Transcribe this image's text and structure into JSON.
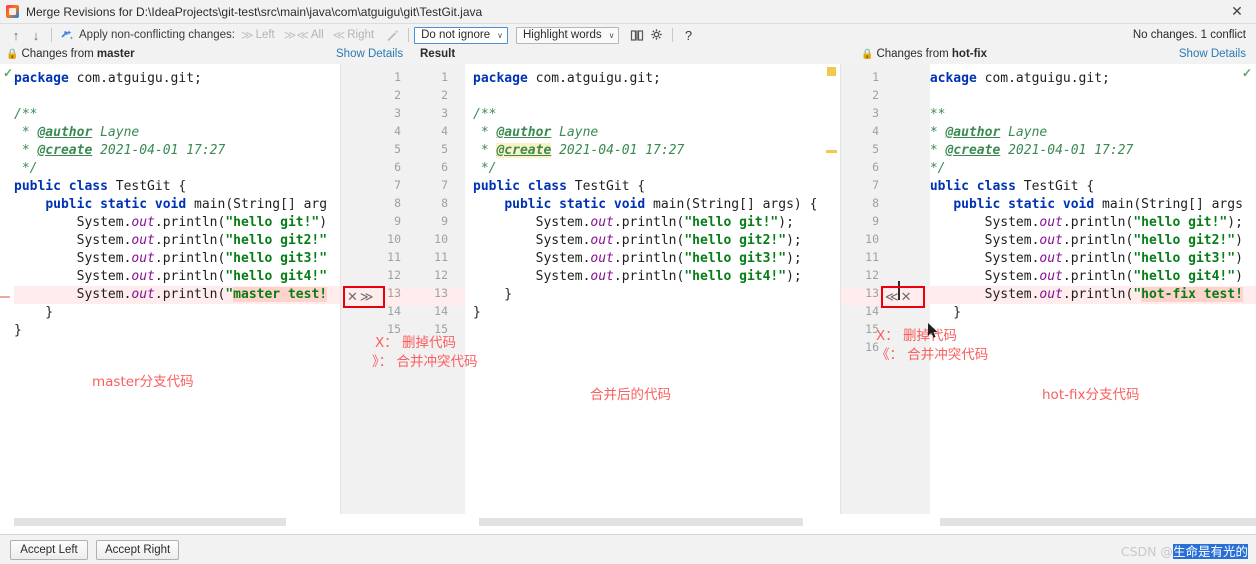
{
  "window": {
    "title": "Merge Revisions for D:\\IdeaProjects\\git-test\\src\\main\\java\\com\\atguigu\\git\\TestGit.java",
    "app_icon": "intellij-idea-icon",
    "close_label": "✕"
  },
  "toolbar": {
    "prev_icon": "↑",
    "next_icon": "↓",
    "magic_apply_icon": "apply-non-conflicting-icon",
    "apply_label": "Apply non-conflicting changes:",
    "actions": [
      {
        "name": "apply-left",
        "chev": "≫",
        "label": "Left"
      },
      {
        "name": "apply-all",
        "chev": "≫≪",
        "label": "All"
      },
      {
        "name": "apply-right",
        "chev": "≪",
        "label": "Right"
      }
    ],
    "wand_icon": "magic-wand-icon",
    "ignore_combo": {
      "value": "Do not ignore",
      "arrow": "∨"
    },
    "highlight_combo": {
      "value": "Highlight words",
      "arrow": "∨"
    },
    "columns_icon": "side-by-side-view-icon",
    "settings_icon": "gear-icon",
    "help_icon": "?"
  },
  "subbar": {
    "left_prefix": "Changes from",
    "left_branch": "master",
    "show_details_left": "Show Details",
    "result_label": "Result",
    "right_prefix": "Changes from",
    "right_branch": "hot-fix",
    "show_details_right": "Show Details",
    "status": "No changes. 1 conflict",
    "lock_icon": "lock-icon"
  },
  "panes": {
    "left": {
      "name": "master-pane",
      "line_numbers": [],
      "lines": [
        [
          {
            "t": "kw",
            "s": "package"
          },
          {
            "t": "pl",
            "s": " com.atguigu.git;"
          }
        ],
        [],
        [
          {
            "t": "cm",
            "s": "/**"
          }
        ],
        [
          {
            "t": "cm",
            "s": " * "
          },
          {
            "t": "tagd",
            "s": "@author"
          },
          {
            "t": "cm",
            "s": " Layne"
          }
        ],
        [
          {
            "t": "cm",
            "s": " * "
          },
          {
            "t": "tagd",
            "s": "@create"
          },
          {
            "t": "cm",
            "s": " 2021-04-01 17:27"
          }
        ],
        [
          {
            "t": "cm",
            "s": " */"
          }
        ],
        [
          {
            "t": "kw",
            "s": "public class"
          },
          {
            "t": "pl",
            "s": " TestGit {"
          }
        ],
        [
          {
            "t": "pl",
            "s": "    "
          },
          {
            "t": "kw",
            "s": "public static void"
          },
          {
            "t": "pl",
            "s": " main(String[] arg"
          }
        ],
        [
          {
            "t": "pl",
            "s": "        System."
          },
          {
            "t": "fld",
            "s": "out"
          },
          {
            "t": "pl",
            "s": ".println("
          },
          {
            "t": "str",
            "s": "\"hello git!\""
          },
          {
            "t": "pl",
            "s": ")"
          }
        ],
        [
          {
            "t": "pl",
            "s": "        System."
          },
          {
            "t": "fld",
            "s": "out"
          },
          {
            "t": "pl",
            "s": ".println("
          },
          {
            "t": "str",
            "s": "\"hello git2!\""
          }
        ],
        [
          {
            "t": "pl",
            "s": "        System."
          },
          {
            "t": "fld",
            "s": "out"
          },
          {
            "t": "pl",
            "s": ".println("
          },
          {
            "t": "str",
            "s": "\"hello git3!\""
          }
        ],
        [
          {
            "t": "pl",
            "s": "        System."
          },
          {
            "t": "fld",
            "s": "out"
          },
          {
            "t": "pl",
            "s": ".println("
          },
          {
            "t": "str",
            "s": "\"hello git4!\""
          }
        ],
        [
          {
            "t": "pl",
            "s": "        System."
          },
          {
            "t": "fld",
            "s": "out"
          },
          {
            "t": "pl",
            "s": ".println("
          },
          {
            "t": "str",
            "s": "\""
          },
          {
            "t": "confl",
            "s": "master test!"
          }
        ],
        [
          {
            "t": "pl",
            "s": "    }"
          }
        ],
        [
          {
            "t": "pl",
            "s": "}"
          }
        ]
      ]
    },
    "result": {
      "name": "result-pane",
      "lines": [
        [
          {
            "t": "kw",
            "s": "package"
          },
          {
            "t": "pl",
            "s": " com.atguigu.git;"
          }
        ],
        [],
        [
          {
            "t": "cm",
            "s": "/**"
          }
        ],
        [
          {
            "t": "cm",
            "s": " * "
          },
          {
            "t": "tagd",
            "s": "@author"
          },
          {
            "t": "cm",
            "s": " Layne"
          }
        ],
        [
          {
            "t": "cm",
            "s": " * "
          },
          {
            "t": "tagdh",
            "s": "@create"
          },
          {
            "t": "cm",
            "s": " 2021-04-01 17:27"
          }
        ],
        [
          {
            "t": "cm",
            "s": " */"
          }
        ],
        [
          {
            "t": "kw",
            "s": "public class"
          },
          {
            "t": "pl",
            "s": " TestGit {"
          }
        ],
        [
          {
            "t": "pl",
            "s": "    "
          },
          {
            "t": "kw",
            "s": "public static void"
          },
          {
            "t": "pl",
            "s": " main(String[] args) {"
          }
        ],
        [
          {
            "t": "pl",
            "s": "        System."
          },
          {
            "t": "fld",
            "s": "out"
          },
          {
            "t": "pl",
            "s": ".println("
          },
          {
            "t": "str",
            "s": "\"hello git!\""
          },
          {
            "t": "pl",
            "s": ");"
          }
        ],
        [
          {
            "t": "pl",
            "s": "        System."
          },
          {
            "t": "fld",
            "s": "out"
          },
          {
            "t": "pl",
            "s": ".println("
          },
          {
            "t": "str",
            "s": "\"hello git2!\""
          },
          {
            "t": "pl",
            "s": ");"
          }
        ],
        [
          {
            "t": "pl",
            "s": "        System."
          },
          {
            "t": "fld",
            "s": "out"
          },
          {
            "t": "pl",
            "s": ".println("
          },
          {
            "t": "str",
            "s": "\"hello git3!\""
          },
          {
            "t": "pl",
            "s": ");"
          }
        ],
        [
          {
            "t": "pl",
            "s": "        System."
          },
          {
            "t": "fld",
            "s": "out"
          },
          {
            "t": "pl",
            "s": ".println("
          },
          {
            "t": "str",
            "s": "\"hello git4!\""
          },
          {
            "t": "pl",
            "s": ");"
          }
        ],
        [
          {
            "t": "pl",
            "s": "    }"
          }
        ],
        [
          {
            "t": "pl",
            "s": "}"
          }
        ]
      ]
    },
    "right": {
      "name": "hot-fix-pane",
      "lines": [
        [
          {
            "t": "kw",
            "s": "package"
          },
          {
            "t": "pl",
            "s": " com.atguigu.git;"
          }
        ],
        [],
        [
          {
            "t": "cm",
            "s": "/**"
          }
        ],
        [
          {
            "t": "cm",
            "s": " * "
          },
          {
            "t": "tagd",
            "s": "@author"
          },
          {
            "t": "cm",
            "s": " Layne"
          }
        ],
        [
          {
            "t": "cm",
            "s": " * "
          },
          {
            "t": "tagd",
            "s": "@create"
          },
          {
            "t": "cm",
            "s": " 2021-04-01 17:27"
          }
        ],
        [
          {
            "t": "cm",
            "s": " */"
          }
        ],
        [
          {
            "t": "kw",
            "s": "public class"
          },
          {
            "t": "pl",
            "s": " TestGit {"
          }
        ],
        [
          {
            "t": "pl",
            "s": "    "
          },
          {
            "t": "kw",
            "s": "public static void"
          },
          {
            "t": "pl",
            "s": " main(String[] args"
          }
        ],
        [
          {
            "t": "pl",
            "s": "        System."
          },
          {
            "t": "fld",
            "s": "out"
          },
          {
            "t": "pl",
            "s": ".println("
          },
          {
            "t": "str",
            "s": "\"hello git!\""
          },
          {
            "t": "pl",
            "s": ");"
          }
        ],
        [
          {
            "t": "pl",
            "s": "        System."
          },
          {
            "t": "fld",
            "s": "out"
          },
          {
            "t": "pl",
            "s": ".println("
          },
          {
            "t": "str",
            "s": "\"hello git2!\""
          },
          {
            "t": "pl",
            "s": ")"
          }
        ],
        [
          {
            "t": "pl",
            "s": "        System."
          },
          {
            "t": "fld",
            "s": "out"
          },
          {
            "t": "pl",
            "s": ".println("
          },
          {
            "t": "str",
            "s": "\"hello git3!\""
          },
          {
            "t": "pl",
            "s": ")"
          }
        ],
        [
          {
            "t": "pl",
            "s": "        System."
          },
          {
            "t": "fld",
            "s": "out"
          },
          {
            "t": "pl",
            "s": ".println("
          },
          {
            "t": "str",
            "s": "\"hello git4!\""
          },
          {
            "t": "pl",
            "s": ")"
          }
        ],
        [
          {
            "t": "pl",
            "s": "        System."
          },
          {
            "t": "fld",
            "s": "out"
          },
          {
            "t": "pl",
            "s": ".println("
          },
          {
            "t": "str",
            "s": "\""
          },
          {
            "t": "confl",
            "s": "hot-fix test!"
          }
        ],
        [
          {
            "t": "pl",
            "s": "    }"
          }
        ],
        [
          {
            "t": "pl",
            "s": "}"
          }
        ]
      ]
    }
  },
  "gutters": {
    "left_numbers": [
      "1",
      "2",
      "3",
      "4",
      "5",
      "6",
      "7",
      "8",
      "9",
      "10",
      "11",
      "12",
      "13",
      "14",
      "15"
    ],
    "result_numbers": [
      "1",
      "2",
      "3",
      "4",
      "5",
      "6",
      "7",
      "8",
      "9",
      "10",
      "11",
      "12",
      "13",
      "14",
      "15"
    ],
    "right_numbers": [
      "1",
      "2",
      "3",
      "4",
      "5",
      "6",
      "7",
      "8",
      "9",
      "10",
      "11",
      "12",
      "13",
      "14",
      "15",
      "16"
    ],
    "left_conflict_actions": {
      "remove": "✕",
      "accept": "≫",
      "line": "13"
    },
    "right_conflict_actions": {
      "accept": "≪",
      "remove": "✕",
      "line": "13"
    }
  },
  "annotations": {
    "left_legend_x": "X： 删掉代码",
    "left_legend_chev": "》： 合并冲突代码",
    "left_branch_note": "master分支代码",
    "middle_note": "合并后的代码",
    "right_legend_x": "X： 删掉代码",
    "right_legend_chev": "《： 合并冲突代码",
    "right_branch_note": "hot-fix分支代码"
  },
  "bottom": {
    "accept_left": "Accept Left",
    "accept_right": "Accept Right"
  },
  "watermark": {
    "prefix": "CSDN @",
    "user": "生命是有光的"
  },
  "colors": {
    "accent_link": "#2a7ab0",
    "conflict_bg": "#ffecec",
    "conflict_strong": "#ffd2cc",
    "annotation": "#fa5e5e",
    "keyword": "#0033b3",
    "string": "#067d17",
    "comment": "#3a8a52",
    "marker_yellow": "#f2c94c"
  }
}
